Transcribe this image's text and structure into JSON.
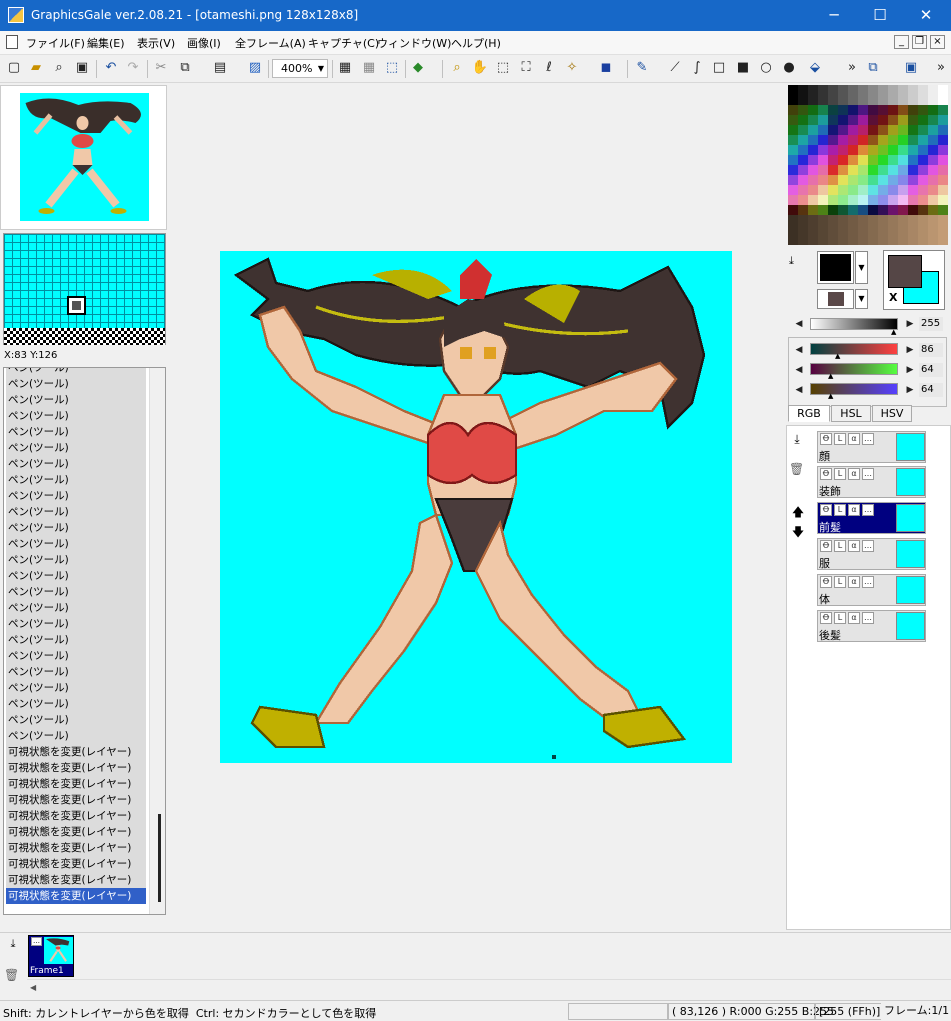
{
  "window": {
    "title": "GraphicsGale ver.2.08.21 - [otameshi.png 128x128x8]",
    "minimize": "─",
    "maximize": "☐",
    "close": "✕",
    "mdi_minimize": "_",
    "mdi_restore": "❐",
    "mdi_close": "×"
  },
  "menu": [
    "ファイル(F)",
    "編集(E)",
    "表示(V)",
    "画像(I)",
    "全フレーム(A)",
    "キャプチャ(C)",
    "ウィンドウ(W)",
    "ヘルプ(H)"
  ],
  "toolbar": {
    "zoom": "400%",
    "icons": [
      "new-icon",
      "open-icon",
      "zoom-icon",
      "save-icon",
      "undo-icon",
      "redo-icon",
      "cut-icon",
      "copy-icon",
      "paste-icon",
      "paste-new-icon",
      "grid-icon",
      "pixel-grid-icon",
      "crop-icon",
      "gradient-tool-icon",
      "zoom-tool-icon",
      "hand-tool-icon",
      "rect-select-icon",
      "lasso-select-icon",
      "freehand-select-icon",
      "magic-wand-icon",
      "color-select-icon",
      "pen-icon",
      "line-icon",
      "curve-icon",
      "rect-icon",
      "filled-rect-icon",
      "ellipse-icon",
      "filled-ellipse-icon",
      "fill-icon",
      "more-icon",
      "layer-add-icon",
      "layer-options-icon",
      "more2-icon"
    ]
  },
  "navigator": {
    "coords": "X:83 Y:126"
  },
  "history": {
    "items": [
      "ペン(ツール)",
      "ペン(ツール)",
      "ペン(ツール)",
      "ペン(ツール)",
      "ペン(ツール)",
      "ペン(ツール)",
      "ペン(ツール)",
      "ペン(ツール)",
      "ペン(ツール)",
      "ペン(ツール)",
      "ペン(ツール)",
      "ペン(ツール)",
      "ペン(ツール)",
      "ペン(ツール)",
      "ペン(ツール)",
      "ペン(ツール)",
      "ペン(ツール)",
      "ペン(ツール)",
      "ペン(ツール)",
      "ペン(ツール)",
      "ペン(ツール)",
      "ペン(ツール)",
      "ペン(ツール)",
      "ペン(ツール)",
      "可視状態を変更(レイヤー)",
      "可視状態を変更(レイヤー)",
      "可視状態を変更(レイヤー)",
      "可視状態を変更(レイヤー)",
      "可視状態を変更(レイヤー)",
      "可視状態を変更(レイヤー)",
      "可視状態を変更(レイヤー)",
      "可視状態を変更(レイヤー)",
      "可視状態を変更(レイヤー)",
      "可視状態を変更(レイヤー)"
    ],
    "current_index": 33
  },
  "colors": {
    "primary": "#000000",
    "secondary": "#5a4848",
    "foreground": "#554646",
    "background": "#00ffff",
    "swap_label": "X",
    "canvas_bg": "#00ffff",
    "accent": "#000080"
  },
  "sliders": {
    "gray": "255",
    "r": "86",
    "g": "64",
    "b": "64"
  },
  "tabs": [
    "RGB",
    "HSL",
    "HSV"
  ],
  "layers": [
    {
      "name": "顔",
      "selected": false
    },
    {
      "name": "装飾",
      "selected": false
    },
    {
      "name": "前髪",
      "selected": true
    },
    {
      "name": "服",
      "selected": false
    },
    {
      "name": "体",
      "selected": false
    },
    {
      "name": "後髪",
      "selected": false
    }
  ],
  "layer_controls": [
    "Ꝋ",
    "L",
    "α",
    "…"
  ],
  "frames": {
    "label": "Frame1"
  },
  "status": {
    "hint": "Shift: カレントレイヤーから色を取得  Ctrl: セカンドカラーとして色を取得",
    "pixel": "( 83,126 ) R:000 G:255 B:255",
    "index": "[255 (FFh)]",
    "frame": "フレーム:1/1"
  }
}
